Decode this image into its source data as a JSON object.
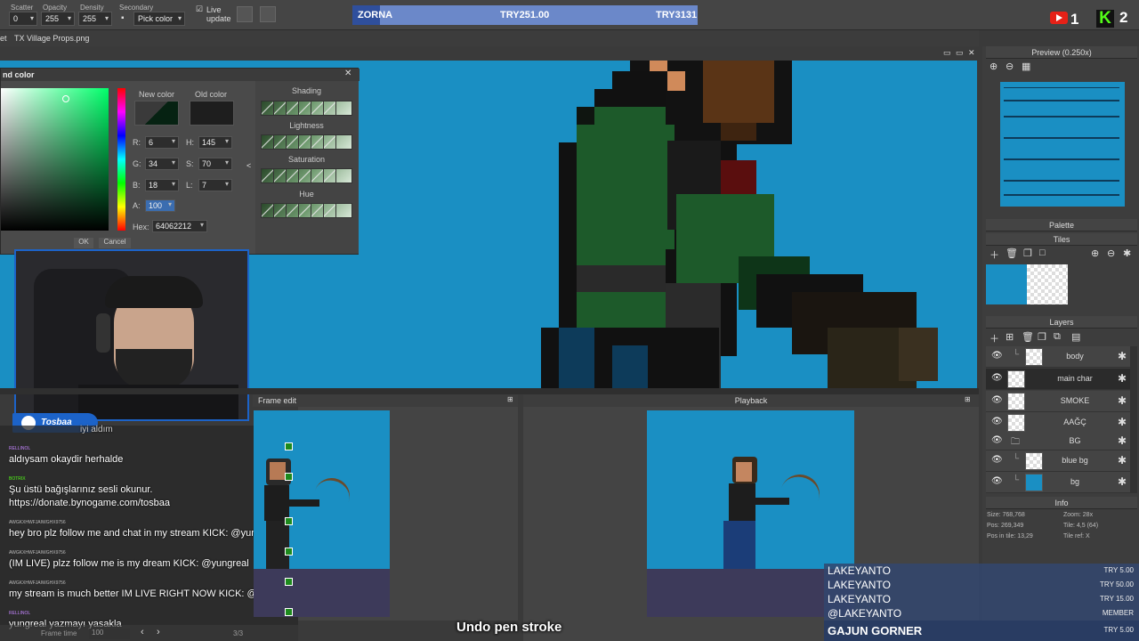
{
  "toolbar": {
    "scatter_label": "Scatter",
    "scatter_value": "0",
    "opacity_label": "Opacity",
    "opacity_value": "255",
    "density_label": "Density",
    "density_value": "255",
    "secondary_label": "Secondary",
    "secondary_value": "Pick color",
    "live_update_label": "Live update"
  },
  "donation_goal": {
    "name": "ZORNA",
    "current": "TRY251.00",
    "target": "TRY3131",
    "progress": 0.08
  },
  "counters": {
    "youtube": "1",
    "kick": "2"
  },
  "tabs": {
    "left": "et",
    "file": "TX Village Props.png"
  },
  "color_dialog": {
    "title": "nd color",
    "new_color_label": "New color",
    "old_color_label": "Old color",
    "r_label": "R:",
    "r": "6",
    "g_label": "G:",
    "g": "34",
    "b_label": "B:",
    "b": "18",
    "a_label": "A:",
    "a": "100",
    "h_label": "H:",
    "h": "145",
    "s_label": "S:",
    "s": "70",
    "l_label": "L:",
    "l": "7",
    "hex_label": "Hex:",
    "hex": "64062212",
    "shading_label": "Shading",
    "lightness_label": "Lightness",
    "saturation_label": "Saturation",
    "hue_label": "Hue",
    "new_color": "#062212",
    "old_color": "#1e1e1e",
    "ok": "OK",
    "cancel": "Cancel"
  },
  "webcam": {
    "badge_name": "Tosbaa"
  },
  "chat": [
    {
      "user": "",
      "msg": "aldıysam okaydir herhalde"
    },
    {
      "user": "BOTRIX",
      "msg": "Şu üstü bağışlarınız sesli okunur."
    },
    {
      "user": "",
      "msg": "https://donate.bynogame.com/tosbaa"
    },
    {
      "user": "AWGKXHWFJAIWGHX9756",
      "msg": "hey bro plz follow me and chat in my stream KICK: @yungreal"
    },
    {
      "user": "AWGKXHWFJAIWGHX9756",
      "msg": "(IM LIVE) plzz follow me is my dream KICK: @yungreal"
    },
    {
      "user": "AWGKXHWFJAIWGHX9756",
      "msg": "my stream is much better IM LIVE RIGHT NOW KICK: @yungreal"
    },
    {
      "user": "RELLINOL",
      "msg": "yungreal yazmayı yasakla"
    }
  ],
  "chat_top_partial": "iyi aldım",
  "frame_edit": {
    "title": "Frame edit",
    "frame_time_label": "Frame time",
    "frame_time": "100",
    "frame_counter": "3/3"
  },
  "playback": {
    "title": "Playback"
  },
  "status_message": "Undo pen stroke",
  "dock": {
    "preview_title": "Preview (0.250x)",
    "palette_title": "Palette",
    "tiles_title": "Tiles",
    "layers_title": "Layers",
    "info_title": "Info",
    "layers": [
      {
        "name": "body",
        "selected": false
      },
      {
        "name": "main char",
        "selected": true
      },
      {
        "name": "SMOKE",
        "selected": false
      },
      {
        "name": "AAĞÇ",
        "selected": false
      },
      {
        "name": "BG",
        "selected": false
      },
      {
        "name": "blue bg",
        "selected": false
      },
      {
        "name": "bg",
        "selected": false
      }
    ],
    "info": {
      "size": "Size: 768,768",
      "zoom": "Zoom: 28x",
      "pos": "Pos: 269,349",
      "tile": "Tile: 4,5 (64)",
      "pos_in_tile": "Pos in tile: 13,29",
      "tile_ref": "Tile ref: X"
    }
  },
  "donors": [
    {
      "name": "LAKEYANTO",
      "amount": "TRY 5.00"
    },
    {
      "name": "LAKEYANTO",
      "amount": "TRY 50.00"
    },
    {
      "name": "LAKEYANTO",
      "amount": "TRY 15.00"
    },
    {
      "name": "@LAKEYANTO",
      "amount": "MEMBER"
    },
    {
      "name": "GAJUN GORNER",
      "amount": "TRY 5.00"
    }
  ],
  "colors": {
    "canvas_bg": "#1a8fc3",
    "accent_blue": "#1c63c9",
    "kick_green": "#53fc18"
  },
  "icons": [
    "brush-icon",
    "eye-icon",
    "gear-icon",
    "zoom-in-icon",
    "zoom-out-icon",
    "plus-icon",
    "trash-icon",
    "folder-icon",
    "youtube-icon",
    "kick-icon"
  ]
}
